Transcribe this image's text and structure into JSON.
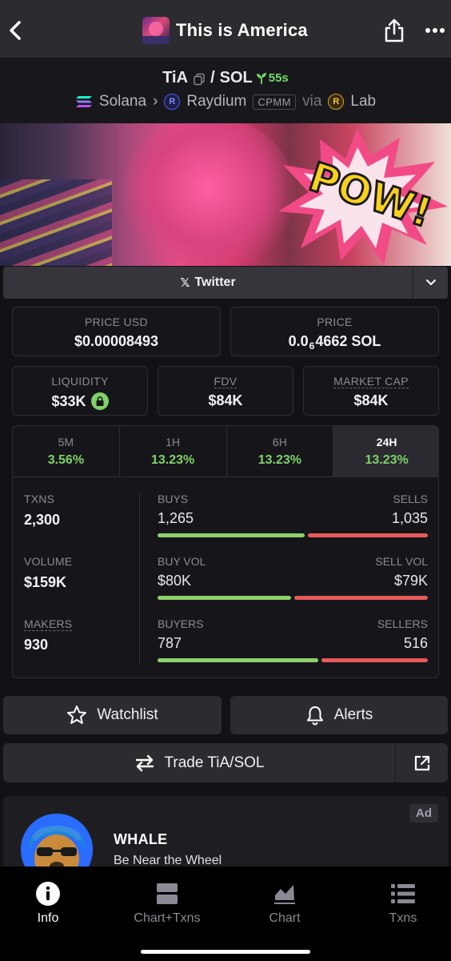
{
  "header": {
    "title": "This is America"
  },
  "pair": {
    "base": "TiA",
    "separator": "/",
    "quote": "SOL",
    "age": "55s",
    "chain": "Solana",
    "dex": "Raydium",
    "pool_type": "CPMM",
    "via_label": "via",
    "launchpad": "Lab"
  },
  "social": {
    "twitter_label": "Twitter"
  },
  "stats": {
    "price_usd": {
      "label": "PRICE USD",
      "value": "$0.00008493"
    },
    "price_native": {
      "label": "PRICE",
      "prefix": "0.0",
      "zeros": "6",
      "digits": "4662",
      "unit": "SOL"
    },
    "liquidity": {
      "label": "LIQUIDITY",
      "value": "$33K"
    },
    "fdv": {
      "label": "FDV",
      "value": "$84K"
    },
    "market_cap": {
      "label": "MARKET CAP",
      "value": "$84K"
    }
  },
  "timeframes": [
    {
      "label": "5M",
      "change": "3.56%"
    },
    {
      "label": "1H",
      "change": "13.23%"
    },
    {
      "label": "6H",
      "change": "13.23%"
    },
    {
      "label": "24H",
      "change": "13.23%"
    }
  ],
  "selected_timeframe": "24H",
  "activity": {
    "txns": {
      "label": "TXNS",
      "value": "2,300"
    },
    "volume": {
      "label": "VOLUME",
      "value": "$159K"
    },
    "makers": {
      "label": "MAKERS",
      "value": "930"
    },
    "buys": {
      "left_label": "BUYS",
      "left_value": "1,265",
      "right_label": "SELLS",
      "right_value": "1,035",
      "buy_ratio": 0.55
    },
    "vol": {
      "left_label": "BUY VOL",
      "left_value": "$80K",
      "right_label": "SELL VOL",
      "right_value": "$79K",
      "buy_ratio": 0.5
    },
    "buyers": {
      "left_label": "BUYERS",
      "left_value": "787",
      "right_label": "SELLERS",
      "right_value": "516",
      "buy_ratio": 0.6
    }
  },
  "actions": {
    "watchlist": "Watchlist",
    "alerts": "Alerts",
    "trade": "Trade TiA/SOL"
  },
  "ad": {
    "badge": "Ad",
    "title": "WHALE",
    "subtitle": "Be Near the Wheel"
  },
  "nav": [
    {
      "label": "Info",
      "icon": "info-icon",
      "active": true
    },
    {
      "label": "Chart+Txns",
      "icon": "chart-txns-icon",
      "active": false
    },
    {
      "label": "Chart",
      "icon": "chart-icon",
      "active": false
    },
    {
      "label": "Txns",
      "icon": "list-icon",
      "active": false
    }
  ],
  "colors": {
    "positive": "#7fd16a",
    "negative": "#e85a5a",
    "background": "#121216"
  }
}
